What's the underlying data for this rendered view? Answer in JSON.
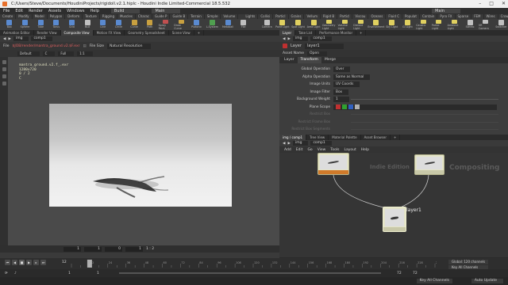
{
  "window": {
    "title": "C:/Users/Steve/Documents/HoudiniProjects/rigidoll.v2.1.hiplc - Houdini Indie Limited-Commercial 18.5.532"
  },
  "menu": {
    "items": [
      "File",
      "Edit",
      "Render",
      "Assets",
      "Windows",
      "Help"
    ],
    "desktop_build": "Build",
    "desktop_main": "Main",
    "desktop_main_right": "Main"
  },
  "shelf": {
    "tabs": [
      "Create",
      "Modify",
      "Model",
      "Polygon",
      "Deform",
      "Texture",
      "Rigging",
      "Muscles",
      "Charac",
      "Guide P",
      "Guide B",
      "Terrain",
      "Simple",
      "Volume"
    ],
    "right_tabs": [
      "Lights",
      "Collisi",
      "Particl",
      "Grains",
      "Vellum",
      "Rigid B",
      "Particl",
      "Viscou",
      "Oceans",
      "Fluid C",
      "Populat",
      "Contain",
      "Pyro FX",
      "Sparse",
      "FEM",
      "Wires",
      "Crowds",
      "Drive"
    ],
    "tools": [
      {
        "label": "Box",
        "icon": "box-icon",
        "color": "#5a8ad0"
      },
      {
        "label": "Sphere",
        "icon": "sphere-icon",
        "color": "#5a8ad0"
      },
      {
        "label": "Tube",
        "icon": "tube-icon",
        "color": "#5a8ad0"
      },
      {
        "label": "Torus",
        "icon": "torus-icon",
        "color": "#5a8ad0"
      },
      {
        "label": "Grid",
        "icon": "grid-icon",
        "color": "#5a8ad0"
      },
      {
        "label": "Null",
        "icon": "null-icon",
        "color": "#c0c0c0"
      },
      {
        "label": "Line",
        "icon": "line-icon",
        "color": "#5a8ad0"
      },
      {
        "label": "Circle",
        "icon": "circle-icon",
        "color": "#5a8ad0"
      },
      {
        "label": "Curve",
        "icon": "curve-icon",
        "color": "#c8a040"
      },
      {
        "label": "Path",
        "icon": "path-icon",
        "color": "#c8a040"
      },
      {
        "label": "Spray Paint",
        "icon": "spray-icon",
        "color": "#c05050"
      },
      {
        "label": "Draw Curve",
        "icon": "draw-curve-icon",
        "color": "#c8a040"
      },
      {
        "label": "Platonic",
        "icon": "platonic-icon",
        "color": "#5a8ad0"
      },
      {
        "label": "L-System",
        "icon": "lsystem-icon",
        "color": "#50a050"
      },
      {
        "label": "Metaball",
        "icon": "metaball-icon",
        "color": "#5a8ad0"
      },
      {
        "label": "File",
        "icon": "file-icon",
        "color": "#c0c0c0"
      }
    ],
    "right_tools": [
      {
        "label": "Camera",
        "icon": "camera-icon",
        "color": "#c0c0c0"
      },
      {
        "label": "Point Light",
        "icon": "point-light-icon",
        "color": "#e0d060"
      },
      {
        "label": "Spot Light",
        "icon": "spot-light-icon",
        "color": "#e0d060"
      },
      {
        "label": "Area Light",
        "icon": "area-light-icon",
        "color": "#e0d060"
      },
      {
        "label": "Geometry Light",
        "icon": "geo-light-icon",
        "color": "#e0d060"
      },
      {
        "label": "Volume Light",
        "icon": "volume-light-icon",
        "color": "#e0d060"
      },
      {
        "label": "Distant Light",
        "icon": "distant-light-icon",
        "color": "#e0d060"
      },
      {
        "label": "Environment",
        "icon": "env-light-icon",
        "color": "#e0d060"
      },
      {
        "label": "Sky Light",
        "icon": "sky-light-icon",
        "color": "#e0d060"
      },
      {
        "label": "GI Light",
        "icon": "gi-light-icon",
        "color": "#e0d060"
      },
      {
        "label": "Caustic Light",
        "icon": "caustic-light-icon",
        "color": "#e0d060"
      },
      {
        "label": "Portal Light",
        "icon": "portal-light-icon",
        "color": "#e0d060"
      },
      {
        "label": "Ambient Light",
        "icon": "ambient-light-icon",
        "color": "#e0d060"
      },
      {
        "label": "Stereo",
        "icon": "stereo-camera-icon",
        "color": "#c0c0c0"
      },
      {
        "label": "VR Camera",
        "icon": "vr-camera-icon",
        "color": "#c0c0c0"
      },
      {
        "label": "Switcher",
        "icon": "switcher-icon",
        "color": "#c0c0c0"
      }
    ]
  },
  "left_pane": {
    "tabs": [
      "Animation Editor",
      "Render View",
      "Composite View",
      "Motion FX View",
      "Geometry Spreadsheet",
      "Scene View"
    ],
    "active_tab": 2,
    "path": [
      "img",
      "comp1"
    ],
    "file_label": "File",
    "file_path": "$JOB/render/mantra_ground.v2.$F.exr",
    "file_size_label": "File Size",
    "resolution": "Natural Resolution",
    "options": [
      "Default",
      "C",
      "Full",
      "1:1"
    ]
  },
  "viewer": {
    "info_lines": [
      "mantra_ground.v2.f_.exr",
      "1280x720",
      "0 / 2",
      "C"
    ]
  },
  "viewer_bottom": {
    "frames": [
      "1",
      "1",
      "0",
      "1"
    ],
    "zoom": "1 : 2"
  },
  "right_pane": {
    "tabs": [
      "Layer",
      "Take List",
      "Performance Monitor"
    ],
    "active_tab": 0,
    "path": [
      "img",
      "comp1"
    ],
    "node_type": "Layer",
    "node_name": "layer1",
    "asset_label": "Asset Name",
    "asset_value": "Open",
    "param_tabs": [
      "Layer",
      "Transform",
      "Merge"
    ],
    "active_param_tab": 1,
    "params": [
      {
        "label": "Global Operation",
        "value": "Over",
        "dim": false
      },
      {
        "label": "Alpha Operation",
        "value": "Same as Normal",
        "dim": false
      },
      {
        "label": "Image Units",
        "value": "UV Coords",
        "dim": false
      },
      {
        "label": "Image Filter",
        "value": "Box",
        "dim": false
      },
      {
        "label": "Background Weight",
        "value": "1",
        "dim": false,
        "slider": true
      },
      {
        "label": "Plane Scope",
        "value": "",
        "dim": false,
        "swatches": [
          "#c03030",
          "#30a030",
          "#3060c0",
          "#b0b0b0"
        ]
      },
      {
        "label": "Restrict Box",
        "value": "",
        "dim": true,
        "slider": true
      },
      {
        "label": "Restrict Frame Box",
        "value": "",
        "dim": true,
        "slider": true
      },
      {
        "label": "Restrict Box Segments",
        "value": "",
        "dim": true,
        "slider": true
      }
    ]
  },
  "network_pane": {
    "tabs": [
      "img / comp1",
      "Tree View",
      "Material Palette",
      "Asset Browser"
    ],
    "active_tab": 0,
    "path": [
      "img",
      "comp1"
    ],
    "menu": [
      "Add",
      "Edit",
      "Go",
      "View",
      "Tools",
      "Layout",
      "Help"
    ],
    "context_labels": [
      "Indie Edition",
      "Compositing"
    ],
    "selected_node": "layer1"
  },
  "timeline": {
    "current_frame": "12",
    "ticks": [
      "12",
      "24",
      "36",
      "48",
      "60",
      "72",
      "84",
      "96",
      "108",
      "120",
      "132",
      "144",
      "156",
      "168",
      "180",
      "192",
      "204",
      "216",
      "228",
      "240"
    ],
    "playhead_frame": 12,
    "frame_max": 240,
    "right_info": [
      "Global: 120 channels",
      "Key All Channels"
    ],
    "range_start": "1",
    "range_start2": "1",
    "range_end": "72",
    "range_end2": "72",
    "keys_label": "Key All Channels",
    "auto_update": "Auto Update"
  }
}
